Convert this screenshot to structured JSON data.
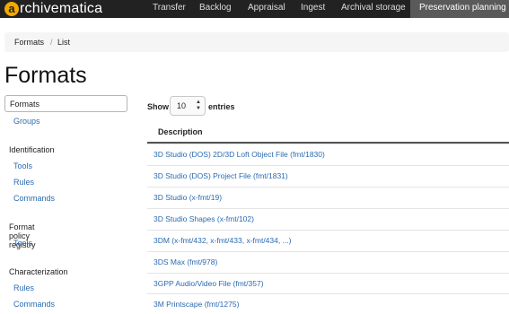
{
  "nav": {
    "brand_letter": "a",
    "brand_text": "rchivematica",
    "items": [
      {
        "label": "Transfer"
      },
      {
        "label": "Backlog"
      },
      {
        "label": "Appraisal"
      },
      {
        "label": "Ingest"
      },
      {
        "label": "Archival storage"
      },
      {
        "label": "Preservation planning"
      }
    ],
    "active_index": 5,
    "brand_accent": "#f2a900"
  },
  "breadcrumb": {
    "items": [
      "Formats",
      "List"
    ],
    "separator": "/"
  },
  "page_title": "Formats",
  "sidebar": {
    "active_item": "Formats",
    "groups_link": "Groups",
    "sections": [
      {
        "heading": "Identification",
        "links": [
          "Tools",
          "Rules",
          "Commands"
        ]
      },
      {
        "heading": "Format policy registry",
        "links": [
          "Tools"
        ]
      },
      {
        "heading": "Characterization",
        "links": [
          "Rules",
          "Commands"
        ]
      }
    ]
  },
  "table": {
    "show_label": "Show",
    "entries_value": "10",
    "entries_label": "entries",
    "column_header": "Description",
    "rows": [
      "3D Studio (DOS) 2D/3D Loft Object File (fmt/1830)",
      "3D Studio (DOS) Project File (fmt/1831)",
      "3D Studio (x-fmt/19)",
      "3D Studio Shapes (x-fmt/102)",
      "3DM (x-fmt/432, x-fmt/433, x-fmt/434, ...)",
      "3DS Max (fmt/978)",
      "3GPP Audio/Video File (fmt/357)",
      "3M Printscape (fmt/1275)"
    ]
  }
}
